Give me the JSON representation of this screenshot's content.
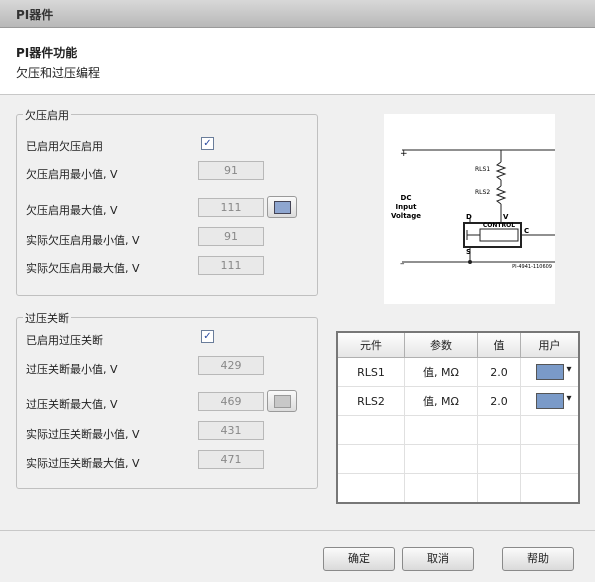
{
  "window": {
    "title": "PI器件"
  },
  "header": {
    "title": "PI器件功能",
    "subtitle": "欠压和过压编程"
  },
  "uv_group": {
    "legend": "欠压启用",
    "enable_label": "已启用欠压启用",
    "enabled": true,
    "fields": [
      {
        "label": "欠压启用最小值, V",
        "value": "91"
      },
      {
        "label": "欠压启用最大值, V",
        "value": "111"
      },
      {
        "label": "实际欠压启用最小值, V",
        "value": "91"
      },
      {
        "label": "实际欠压启用最大值, V",
        "value": "111"
      }
    ]
  },
  "ov_group": {
    "legend": "过压关断",
    "enable_label": "已启用过压关断",
    "enabled": true,
    "fields": [
      {
        "label": "过压关断最小值, V",
        "value": "429"
      },
      {
        "label": "过压关断最大值, V",
        "value": "469"
      },
      {
        "label": "实际过压关断最小值, V",
        "value": "431"
      },
      {
        "label": "实际过压关断最大值, V",
        "value": "471"
      }
    ]
  },
  "diagram": {
    "plus": "+",
    "minus": "–",
    "dc1": "DC",
    "dc2": "Input",
    "dc3": "Voltage",
    "rls1": "RLS1",
    "rls2": "RLS2",
    "d": "D",
    "v": "V",
    "s": "S",
    "c": "C",
    "control": "CONTROL",
    "code": "PI-4941-110609"
  },
  "table": {
    "headers": [
      "元件",
      "参数",
      "值",
      "用户"
    ],
    "rows": [
      {
        "element": "RLS1",
        "param": "值, MΩ",
        "value": "2.0"
      },
      {
        "element": "RLS2",
        "param": "值, MΩ",
        "value": "2.0"
      }
    ]
  },
  "buttons": {
    "ok": "确定",
    "cancel": "取消",
    "help": "帮助"
  },
  "icons": {
    "check": "checkbox-checked-icon",
    "calc": "calculator-icon",
    "user": "calculator-dropdown-icon"
  }
}
